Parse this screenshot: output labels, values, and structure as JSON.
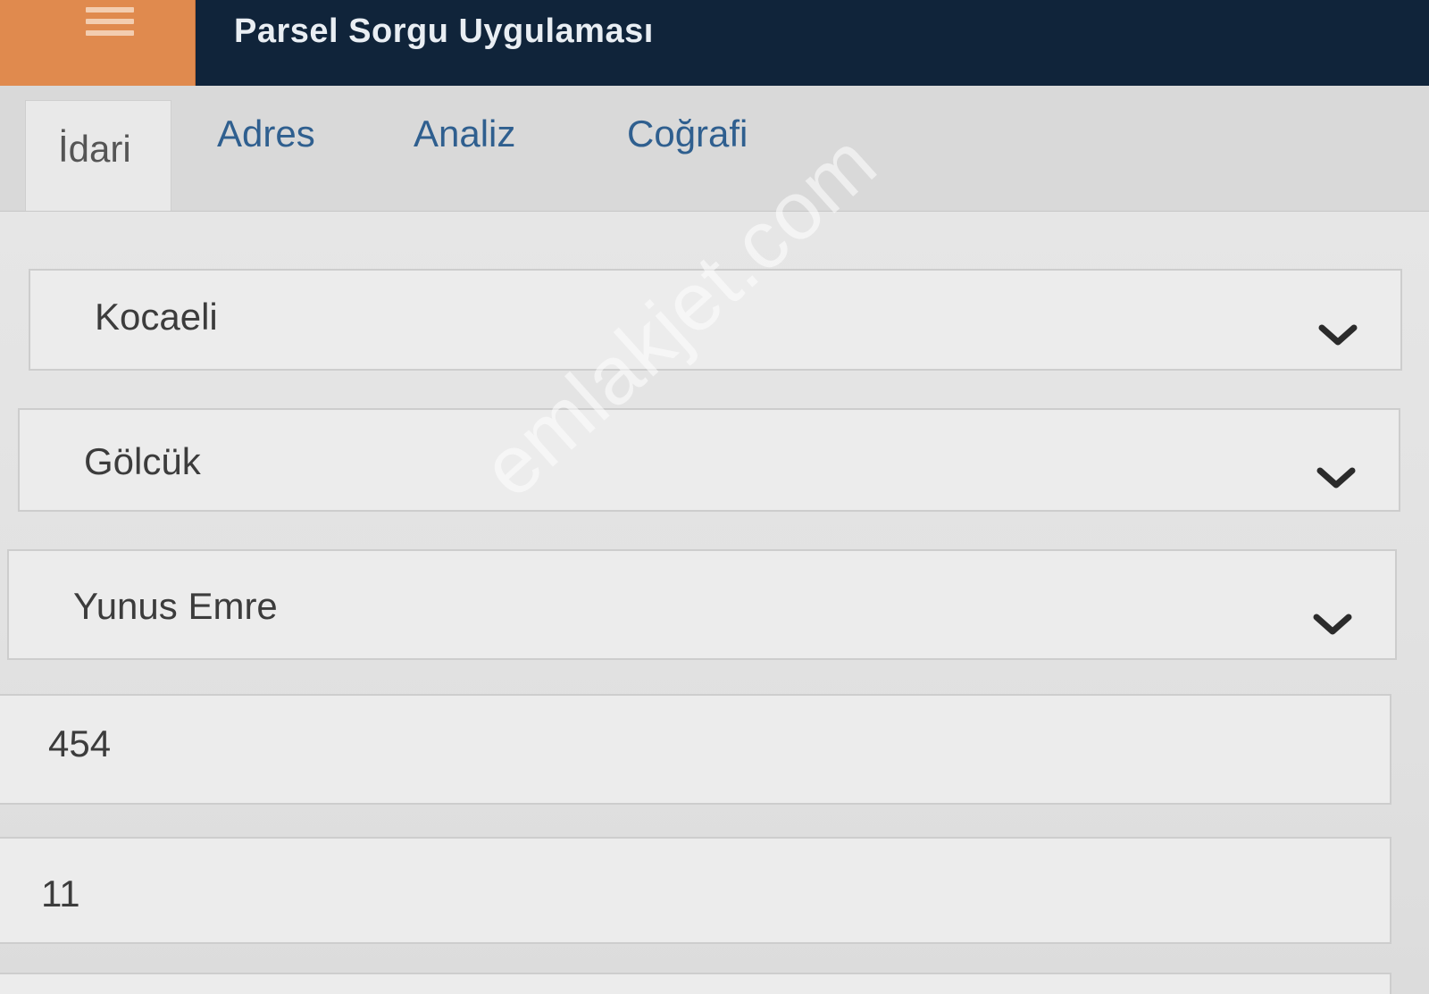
{
  "header": {
    "title": "Parsel Sorgu Uygulaması",
    "menu_icon": "hamburger-menu-icon",
    "accent_color": "#e08a4e",
    "bar_color": "#10243a"
  },
  "tabs": [
    {
      "label": "İdari",
      "active": true
    },
    {
      "label": "Adres",
      "active": false
    },
    {
      "label": "Analiz",
      "active": false
    },
    {
      "label": "Coğrafi",
      "active": false
    }
  ],
  "form": {
    "il": {
      "value": "Kocaeli",
      "icon": "chevron-down-icon"
    },
    "ilce": {
      "value": "Gölcük",
      "icon": "chevron-down-icon"
    },
    "mahalle": {
      "value": "Yunus Emre",
      "icon": "chevron-down-icon"
    },
    "ada": {
      "value": "454"
    },
    "parsel": {
      "value": "11"
    },
    "extra": {
      "value": ""
    }
  },
  "watermark": {
    "text": "emlakjet.com"
  }
}
